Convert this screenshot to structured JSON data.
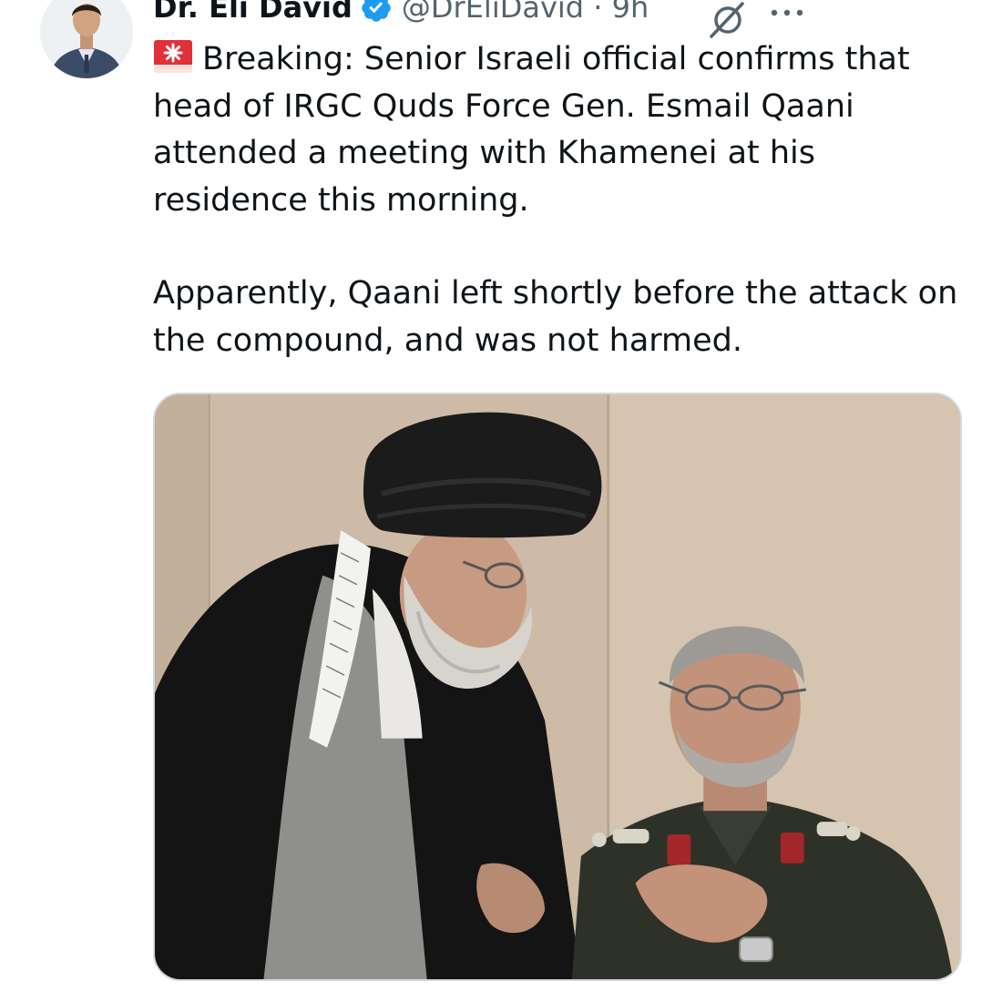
{
  "author": {
    "display_name": "Dr. Eli David",
    "handle_time": "@DrEliDavid · 9h",
    "avatar_icon": "profile-photo",
    "verified_icon": "verified-badge-icon",
    "verified_color": "#1d9bf0"
  },
  "actions": {
    "grok_icon": "grok-icon",
    "more_icon": "more-options-icon"
  },
  "tweet": {
    "emoji": "rotating-light-siren",
    "paragraph_1": "Breaking: Senior Israeli official confirms that head of IRGC Quds Force Gen. Esmail Qaani attended a meeting with Khamenei at his residence this morning.",
    "paragraph_2": "Apparently, Qaani left shortly before the attack on the compound, and was not harmed."
  },
  "media": {
    "type": "photo",
    "icon": "attached-photo"
  }
}
